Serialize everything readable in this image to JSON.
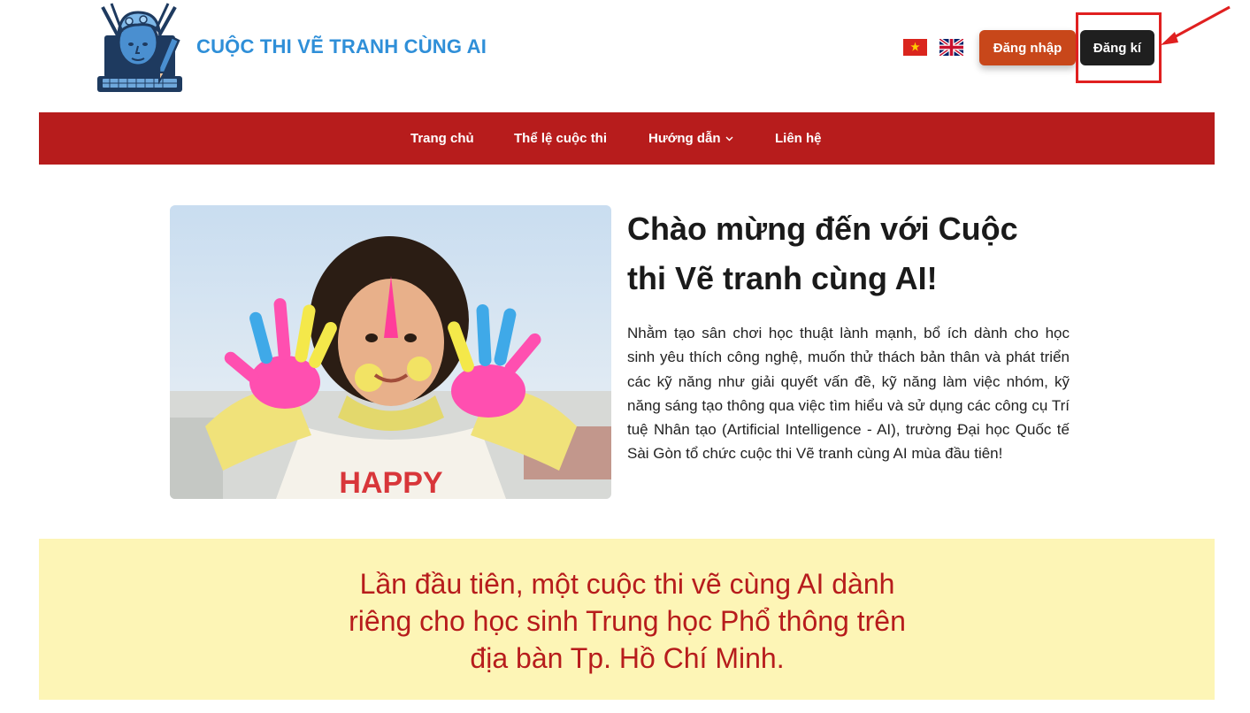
{
  "header": {
    "site_title": "CUỘC THI VẼ TRANH CÙNG AI",
    "login_label": "Đăng nhập",
    "register_label": "Đăng kí"
  },
  "languages": [
    "vi-flag-icon",
    "uk-flag-icon"
  ],
  "nav": {
    "items": [
      {
        "label": "Trang chủ"
      },
      {
        "label": "Thể lệ cuộc thi"
      },
      {
        "label": "Hướng dẫn"
      },
      {
        "label": "Liên hệ"
      }
    ]
  },
  "hero": {
    "title": "Chào mừng đến với Cuộc thi Vẽ tranh cùng AI!",
    "paragraph": "Nhằm tạo sân chơi học thuật lành mạnh, bổ ích dành cho học sinh yêu thích công nghệ, muốn thử thách bản thân và phát triển các kỹ năng như giải quyết vấn đề, kỹ năng làm việc nhóm, kỹ năng sáng tạo thông qua việc tìm hiểu và sử dụng các công cụ Trí tuệ Nhân tạo (Artificial Intelligence - AI), trường Đại học Quốc tế Sài Gòn tổ chức cuộc thi Vẽ tranh cùng AI mùa đầu tiên!",
    "image_text": "HAPPY"
  },
  "banner": {
    "text": "Lần đầu tiên, một cuộc thi vẽ cùng AI dành riêng cho học sinh Trung học Phổ thông trên địa bàn Tp. Hồ Chí Minh."
  },
  "colors": {
    "brand_blue": "#2f8fd8",
    "nav_red": "#b71c1c",
    "login_orange": "#c8471a",
    "register_dark": "#1f1f1f",
    "banner_yellow": "#fdf5b6",
    "annotation_red": "#e02020"
  }
}
